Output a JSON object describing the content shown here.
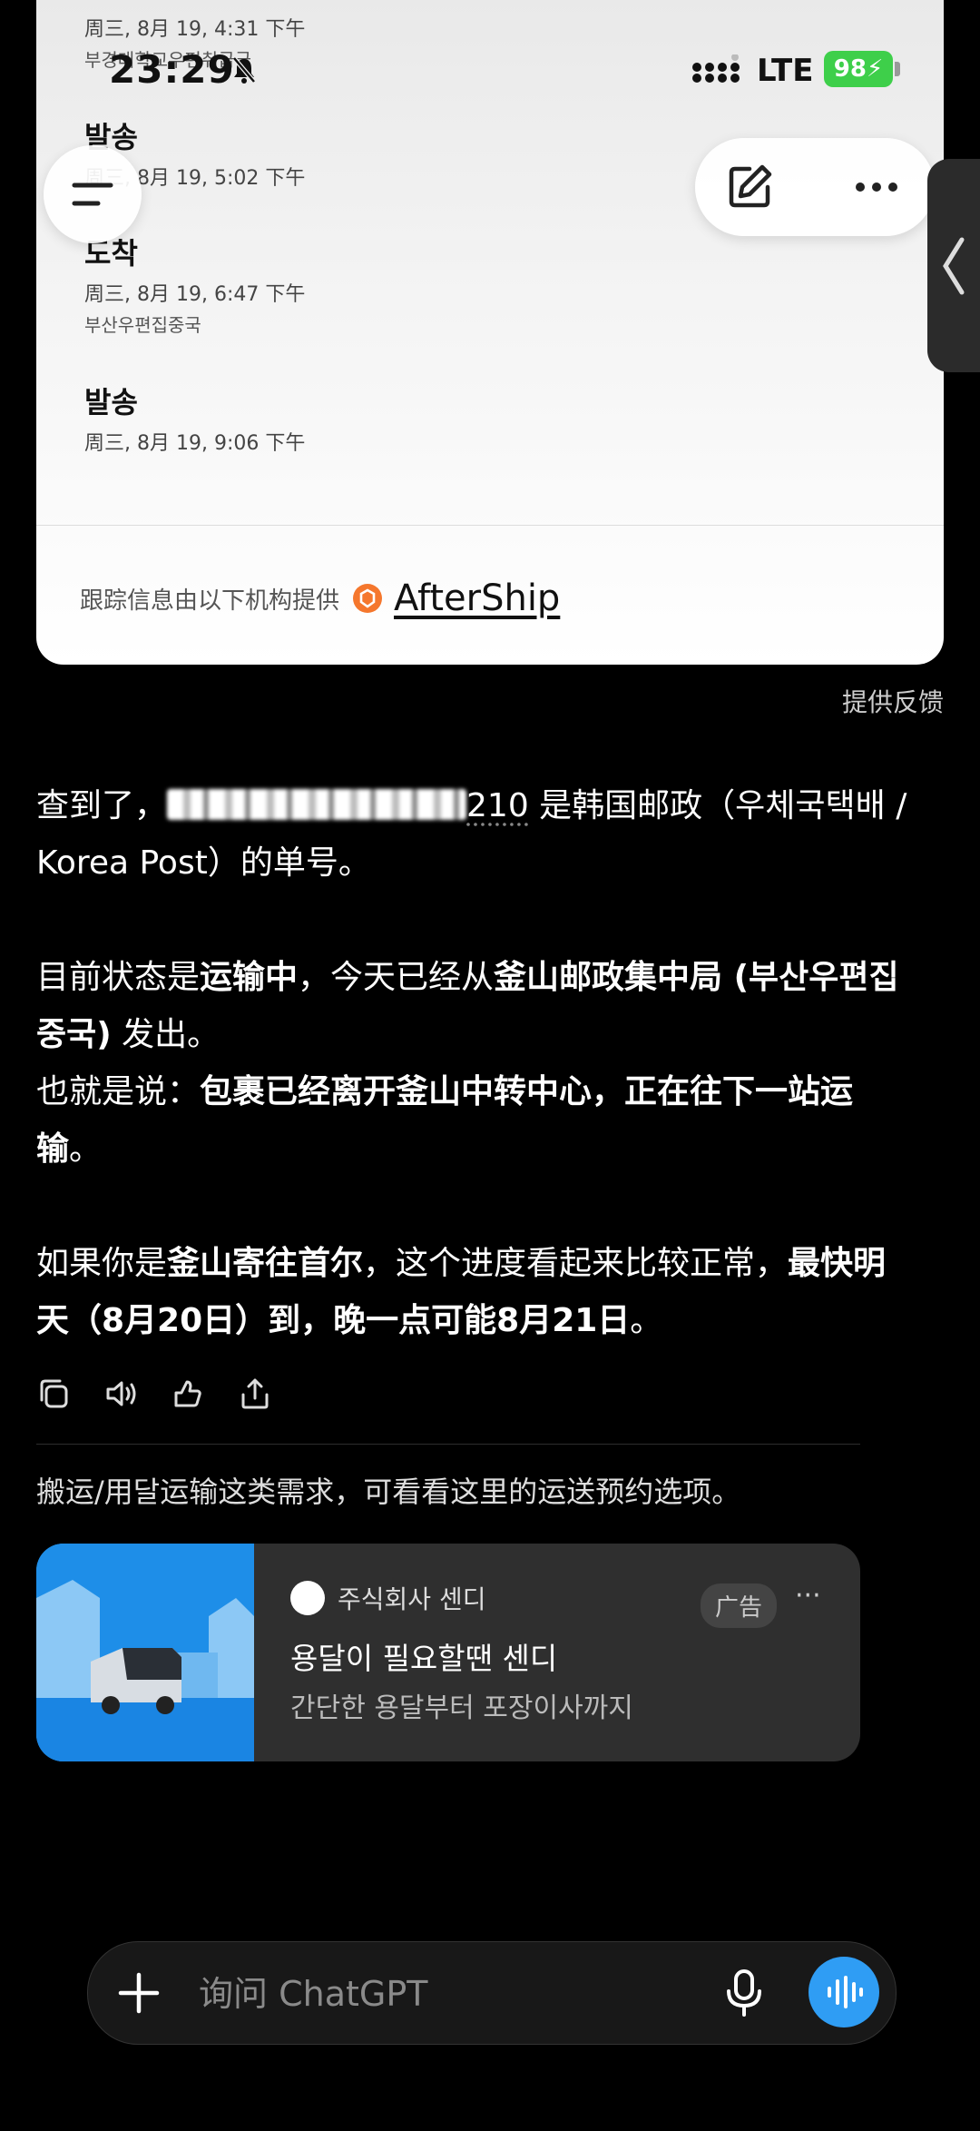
{
  "status_bar": {
    "time": "23:29",
    "network": "LTE",
    "battery": "98"
  },
  "tracking": {
    "events": [
      {
        "status": "",
        "time": "周三, 8月 19, 4:31 下午",
        "location": "부경대학교우편취급국"
      },
      {
        "status": "발송",
        "time": "周三, 8月 19, 5:02 下午",
        "location": ""
      },
      {
        "status": "도착",
        "time": "周三, 8月 19, 6:47 下午",
        "location": "부산우편집중국"
      },
      {
        "status": "발송",
        "time": "周三, 8月 19, 9:06 下午",
        "location": ""
      }
    ],
    "source_label": "跟踪信息由以下机构提供",
    "provider": "AfterShip"
  },
  "feedback": "提供反馈",
  "message": {
    "l1_a": "查到了，",
    "l1_num_end": "210",
    "l1_b": " 是韩国邮政（우체국택배 / Korea Post）的单号。",
    "l2_a": "目前状态是",
    "l2_b": "运输中",
    "l2_c": "，今天已经从",
    "l2_d": "釜山邮政集中局 (부산우편집중국)",
    "l2_e": " 发出。",
    "l3_a": "也就是说：",
    "l3_b": "包裹已经离开釜山中转中心，正在往下一站运输",
    "l3_c": "。",
    "l4_a": "如果你是",
    "l4_b": "釜山寄往首尔",
    "l4_c": "，这个进度看起来比较正常，",
    "l4_d": "最快明天（8月20日）到，晚一点可能8月21日",
    "l4_e": "。"
  },
  "ad": {
    "intro": "搬运/用달运输这类需求，可看看这里的运送预约选项。",
    "brand": "주식회사 센디",
    "title": "용달이 필요할땐 센디",
    "description": "간단한 용달부터 포장이사까지",
    "badge": "广告",
    "more": "···"
  },
  "composer": {
    "placeholder": "询问 ChatGPT"
  }
}
